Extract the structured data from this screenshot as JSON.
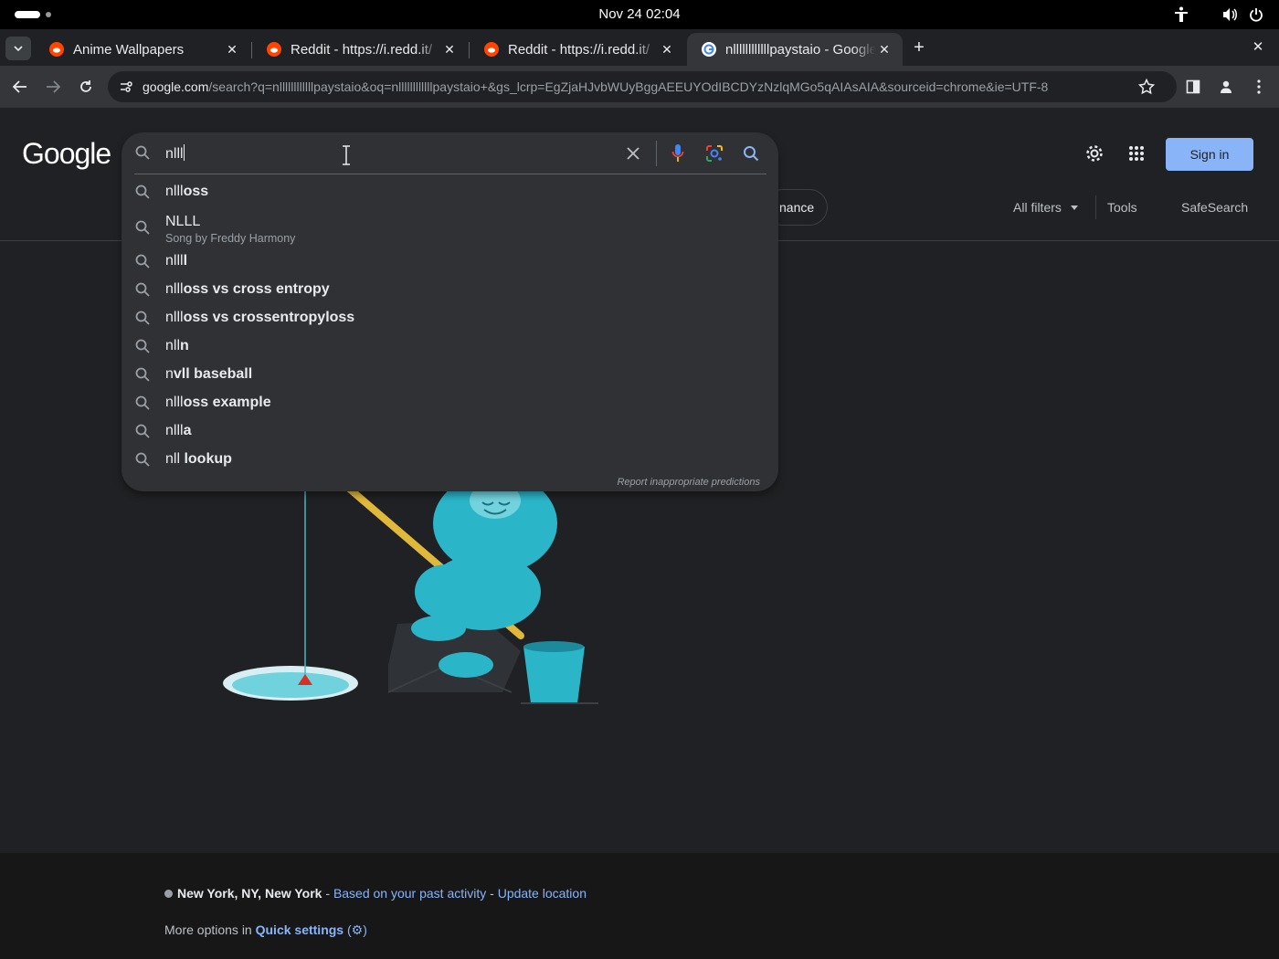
{
  "system": {
    "clock": "Nov 24  02:04"
  },
  "tabs": [
    {
      "title": "Anime Wallpapers",
      "icon": "reddit-icon"
    },
    {
      "title": "Reddit - https://i.redd.it/",
      "icon": "reddit-icon"
    },
    {
      "title": "Reddit - https://i.redd.it/",
      "icon": "reddit-icon"
    },
    {
      "title": "nllllllllllllpaystaio - Google Search",
      "icon": "google-icon",
      "active": true
    }
  ],
  "omnibox": {
    "host": "google.com",
    "path": "/search?q=nllllllllllllpaystaio&oq=nllllllllllllpaystaio+&gs_lcrp=EgZjaHJvbWUyBggAEEUYOdIBCDYzNzlqMGo5qAIAsAIA&sourceid=chrome&ie=UTF-8"
  },
  "header": {
    "logo": "Google",
    "sign_in": "Sign in",
    "chip": "nance",
    "all_filters": "All filters",
    "tools": "Tools",
    "safesearch": "SafeSearch"
  },
  "search": {
    "query": "nlll",
    "report": "Report inappropriate predictions",
    "suggestions": [
      {
        "prefix": "nlll",
        "rest": "oss"
      },
      {
        "prefix": "NLLL",
        "rest": "",
        "sub": "Song by Freddy Harmony"
      },
      {
        "prefix": "nlll",
        "rest": "l"
      },
      {
        "prefix": "nlll",
        "rest": "oss vs cross entropy"
      },
      {
        "prefix": "nlll",
        "rest": "oss vs crossentropyloss"
      },
      {
        "prefix": "nll",
        "rest": "n"
      },
      {
        "prefix": "n",
        "rest": "vll baseball"
      },
      {
        "prefix": "nlll",
        "rest": "oss example"
      },
      {
        "prefix": "nlll",
        "rest": "a"
      },
      {
        "prefix": "nll",
        "rest": " lookup"
      }
    ]
  },
  "footer": {
    "location": "New York, NY, New York",
    "dash1": " - ",
    "based": "Based on your past activity",
    "dash2": " - ",
    "update": "Update location",
    "more": "More options in ",
    "quick": "Quick settings",
    "paren_open": " (",
    "paren_close": ")"
  },
  "colors": {
    "accent": "#8ab4f8",
    "background": "#202124",
    "dropdown": "#303134"
  }
}
